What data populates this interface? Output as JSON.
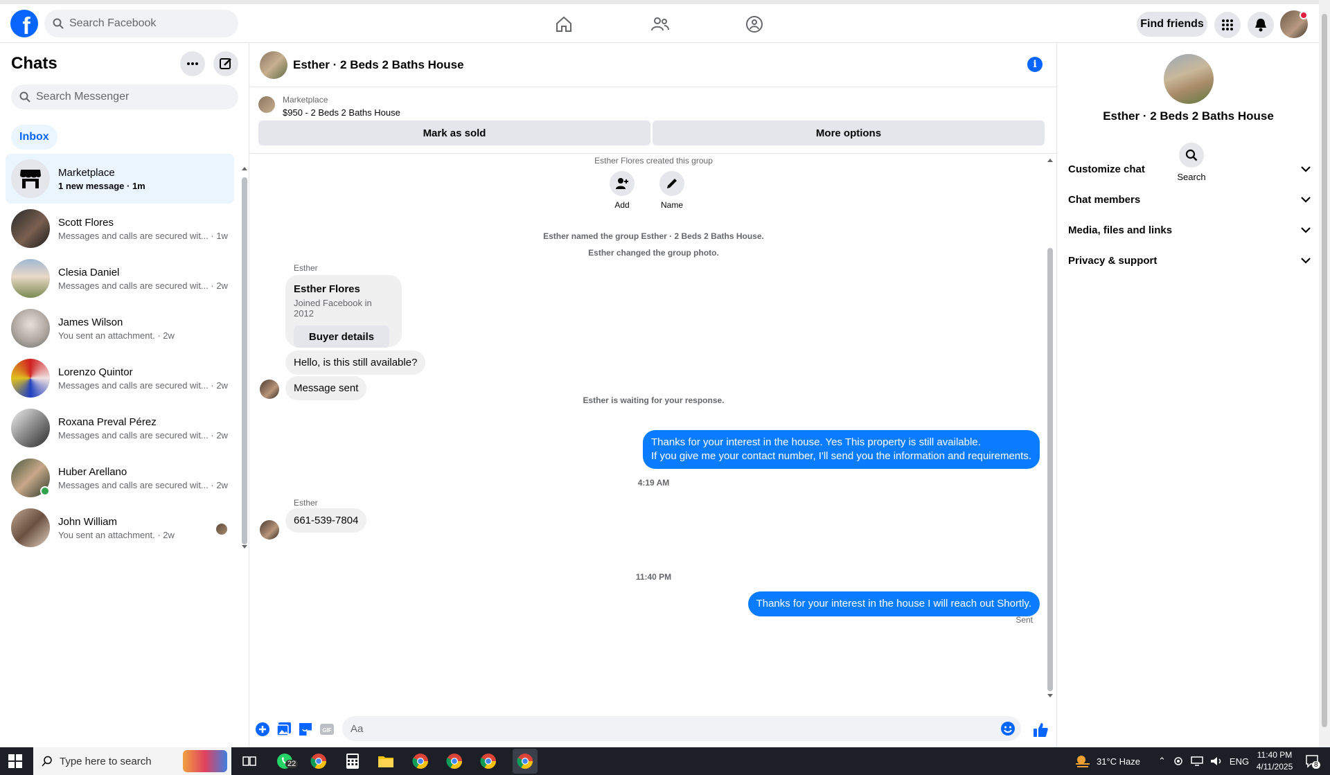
{
  "topbar": {
    "search_placeholder": "Search Facebook",
    "find_friends": "Find friends"
  },
  "chats": {
    "title": "Chats",
    "search_placeholder": "Search Messenger",
    "filter": "Inbox",
    "items": [
      {
        "name": "Marketplace",
        "sub": "1 new message · 1m",
        "active": true
      },
      {
        "name": "Scott Flores",
        "sub": "Messages and calls are secured wit... · 1w"
      },
      {
        "name": "Clesia Daniel",
        "sub": "Messages and calls are secured wit... · 2w"
      },
      {
        "name": "James Wilson",
        "sub": "You sent an attachment. · 2w"
      },
      {
        "name": "Lorenzo Quintor",
        "sub": "Messages and calls are secured wit... · 2w"
      },
      {
        "name": "Roxana Preval Pérez",
        "sub": "Messages and calls are secured wit... · 2w"
      },
      {
        "name": "Huber Arellano",
        "sub": "Messages and calls are secured wit... · 2w"
      },
      {
        "name": "John William",
        "sub": "You sent an attachment. · 2w"
      }
    ]
  },
  "conversation": {
    "title": "Esther · 2 Beds 2 Baths House",
    "marketplace_label": "Marketplace",
    "listing": "$950 - 2 Beds 2 Baths House",
    "mark_sold": "Mark as sold",
    "more_options": "More options",
    "created": "Esther Flores created this group",
    "add_label": "Add",
    "name_label": "Name",
    "named_event": "Esther named the group Esther · 2 Beds 2 Baths House.",
    "photo_event": "Esther changed the group photo.",
    "sender_name": "Esther",
    "card_name": "Esther Flores",
    "card_joined": "Joined Facebook in 2012",
    "card_button": "Buyer details",
    "msg_available": "Hello, is this still available?",
    "msg_sent": "Message sent",
    "waiting": "Esther is waiting for your response.",
    "reply_line1": "Thanks for your interest in the house. Yes This property is still available.",
    "reply_line2": "If you give me your contact number, I'll send you the information and requirements.",
    "time1": "4:19 AM",
    "phone": "661-539-7804",
    "time2": "11:40 PM",
    "reply_final": "Thanks for your interest in the house I will reach out Shortly.",
    "sent_status": "Sent",
    "composer_placeholder": "Aa"
  },
  "info_panel": {
    "title": "Esther · 2 Beds 2 Baths House",
    "search_label": "Search",
    "sections": [
      "Customize chat",
      "Chat members",
      "Media, files and links",
      "Privacy & support"
    ]
  },
  "taskbar": {
    "search_placeholder": "Type here to search",
    "whatsapp_badge": "22",
    "weather": "31°C  Haze",
    "language": "ENG",
    "time": "11:40 PM",
    "date": "4/11/2025",
    "notif_count": "8"
  },
  "colors": {
    "brand_blue": "#0866ff",
    "outgoing_bubble": "#0a7cff",
    "active_chat_bg": "#ebf5ff"
  }
}
